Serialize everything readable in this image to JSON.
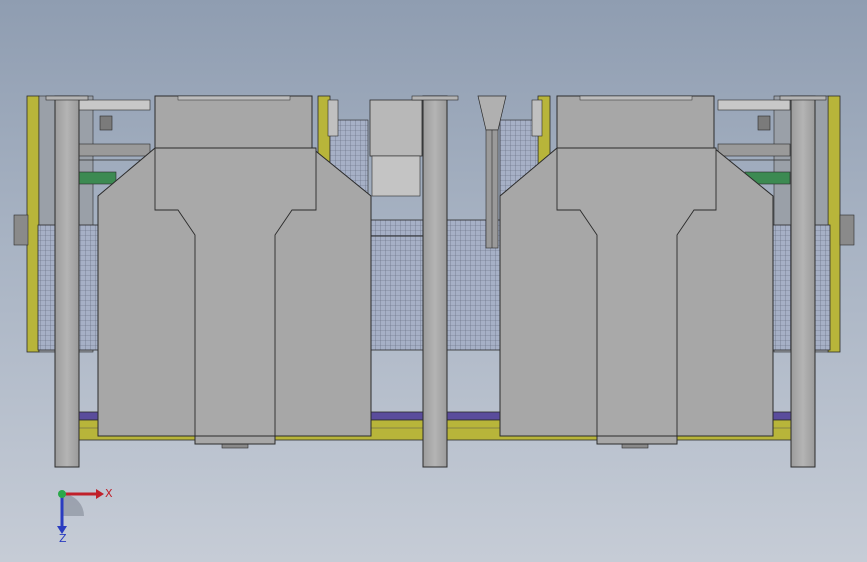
{
  "viewport": {
    "background_top": "#8f9db1",
    "background_bottom": "#c6ccd6"
  },
  "colors": {
    "frame_yellow": "#b8b53a",
    "panel_gray": "#a7a7a7",
    "mesh_blue": "#9aa6c0",
    "conveyor_green": "#3c8a52",
    "base_purple": "#5a4c9c",
    "outline": "#2b2b2b"
  },
  "triad": {
    "x_label": "X",
    "z_label": "Z",
    "x_color": "#c0202a",
    "y_color": "#2aa84a",
    "z_color": "#2a3cc0"
  }
}
